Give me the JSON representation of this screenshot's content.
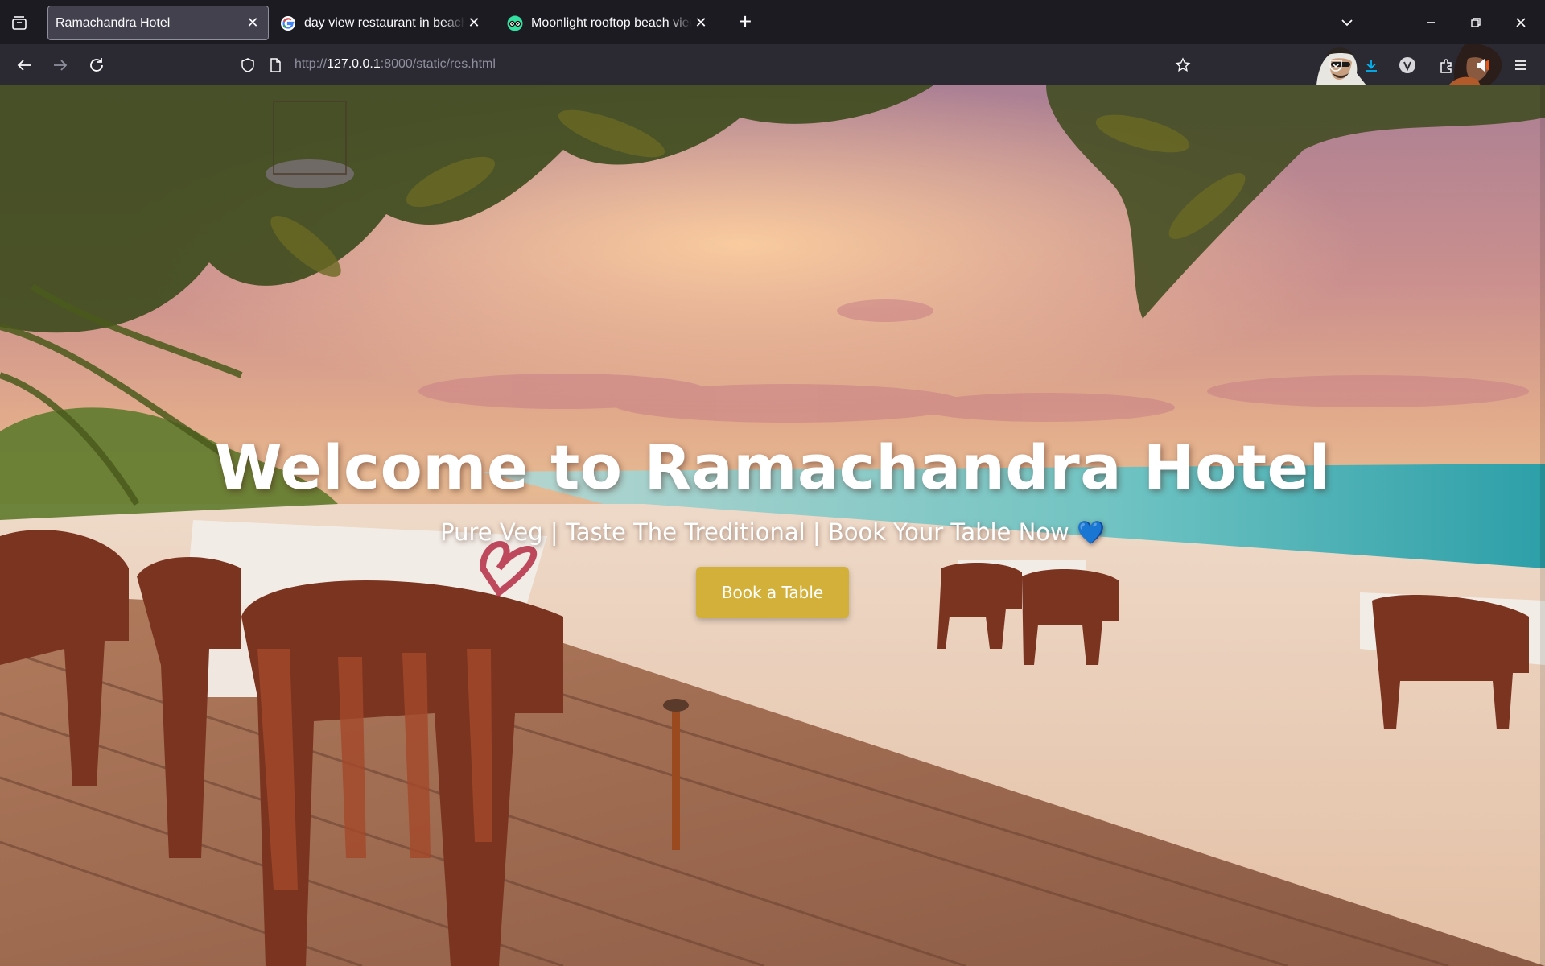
{
  "browser": {
    "tabs": [
      {
        "title": "Ramachandra Hotel",
        "active": true
      },
      {
        "title": "day view restaurant in beach - Google",
        "active": false,
        "favicon": "google-icon"
      },
      {
        "title": "Moonlight rooftop beach view cafe",
        "active": false,
        "favicon": "tripadvisor-icon"
      }
    ],
    "new_tab_label": "+",
    "url": {
      "scheme": "http://",
      "host": "127.0.0.1",
      "rest": ":8000/static/res.html"
    },
    "toolbar_icons": [
      "back-icon",
      "forward-icon",
      "reload-icon",
      "shield-icon",
      "page-icon",
      "bookmark-star-icon",
      "pocket-icon",
      "download-icon",
      "vpn-v-icon",
      "extensions-icon",
      "menu-icon"
    ],
    "colors": {
      "accent": "#00b3f4",
      "chrome": "#1c1b22",
      "toolbar": "#2b2a33"
    }
  },
  "hero": {
    "title": "Welcome to Ramachandra Hotel",
    "subtitle": "Pure Veg | Taste The Treditional | Book Your Table Now",
    "heart": "💙",
    "cta_label": "Book a Table",
    "cta_color": "#d2b039"
  }
}
